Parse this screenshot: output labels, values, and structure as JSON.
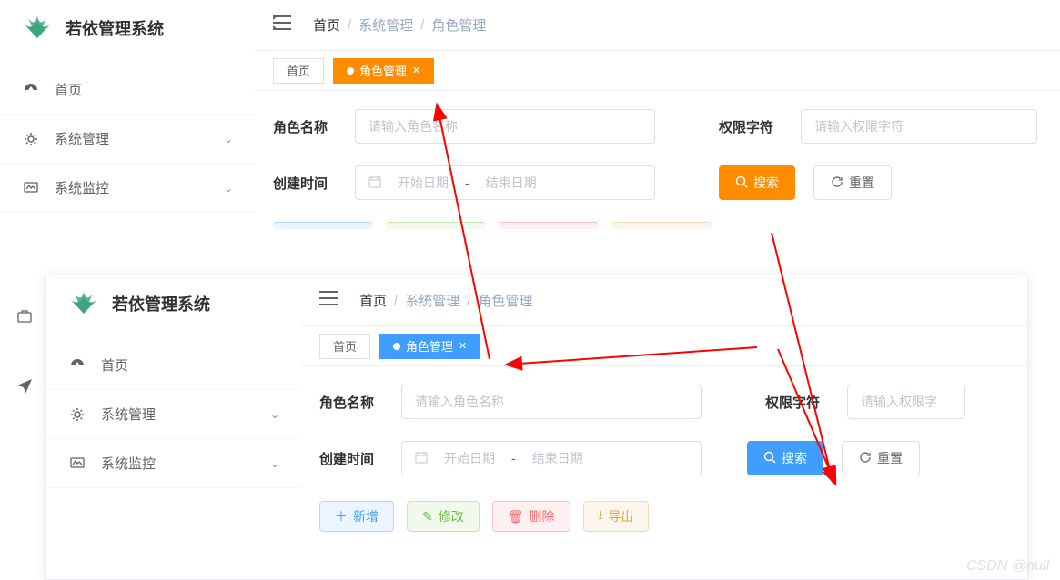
{
  "app_name": "若依管理系统",
  "sidebar": {
    "items": [
      {
        "label": "首页",
        "icon": "dashboard",
        "expandable": false
      },
      {
        "label": "系统管理",
        "icon": "gear",
        "expandable": true
      },
      {
        "label": "系统监控",
        "icon": "monitor",
        "expandable": true
      }
    ]
  },
  "breadcrumb": {
    "home": "首页",
    "group": "系统管理",
    "page": "角色管理"
  },
  "tabs": {
    "home": "首页",
    "active": "角色管理"
  },
  "form": {
    "role_name_label": "角色名称",
    "role_name_placeholder": "请输入角色名称",
    "perm_key_label": "权限字符",
    "perm_key_placeholder": "请输入权限字符",
    "create_time_label": "创建时间",
    "date_start_placeholder": "开始日期",
    "date_sep": "-",
    "date_end_placeholder": "结束日期",
    "search_btn": "搜索",
    "reset_btn": "重置"
  },
  "actions": {
    "add": "新增",
    "edit": "修改",
    "delete": "删除",
    "export": "导出"
  },
  "theme": {
    "orange": "#ff8c00",
    "blue": "#409eff",
    "arrow": "#ff0000"
  },
  "watermark": "CSDN @null"
}
